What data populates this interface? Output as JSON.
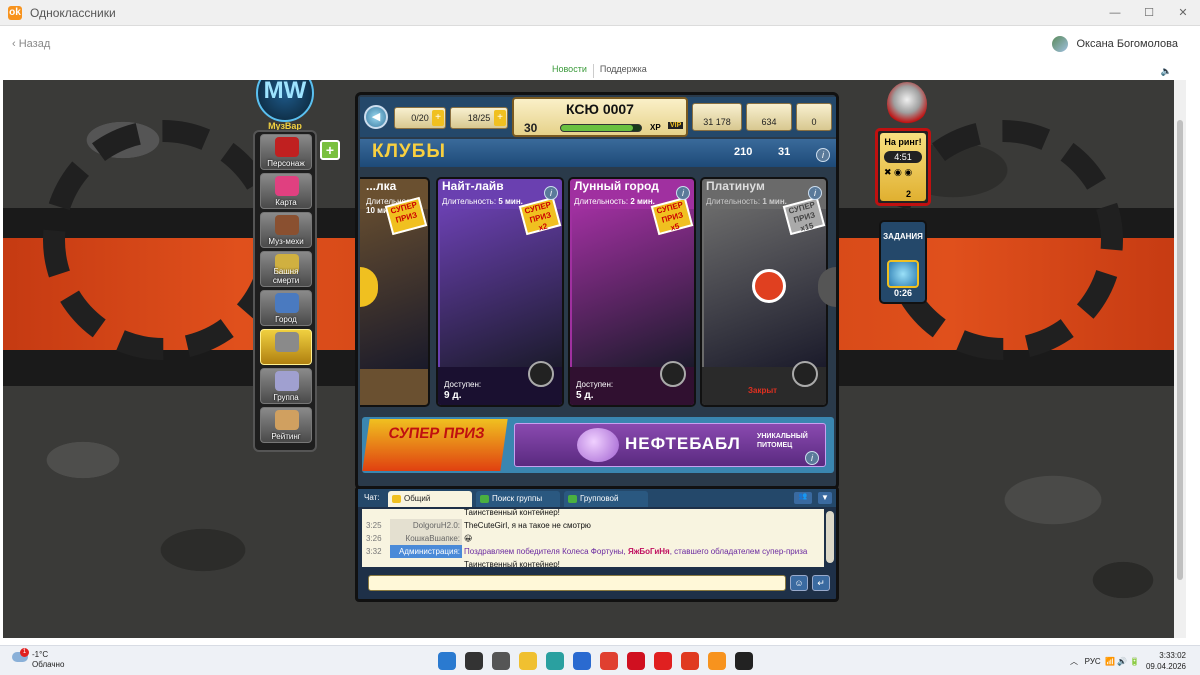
{
  "window": {
    "title": "Одноклассники",
    "min": "—",
    "max": "☐",
    "close": "✕"
  },
  "nav": {
    "back": "Назад",
    "user_name": "Оксана Богомолова"
  },
  "subnav": {
    "news": "Новости",
    "support": "Поддержка"
  },
  "game": {
    "logo": "MW",
    "logo_sub": "МузВар",
    "menu": [
      {
        "label": "Персонаж",
        "color": "#c02020"
      },
      {
        "label": "Карта",
        "color": "#e04080"
      },
      {
        "label": "Муз-мехи",
        "color": "#8a5030"
      },
      {
        "label": "Башня смерти",
        "color": "#d0b040"
      },
      {
        "label": "Город",
        "color": "#4a7ac0"
      },
      {
        "label": "",
        "color": "#8a8a8a"
      },
      {
        "label": "Группа",
        "color": "#a0a0d0"
      },
      {
        "label": "Рейтинг",
        "color": "#d0a060"
      }
    ],
    "add_button": "+",
    "topbar": {
      "weapons": "0/20",
      "energy": "18/25",
      "name": "КСЮ 0007",
      "level": "30",
      "xp_label": "XP",
      "vip": "VIP",
      "money": "31 178",
      "stars": "634",
      "gems": "0",
      "xp_fraction": 0.9
    },
    "clubs": {
      "title": "КЛУБЫ",
      "stat1": "210",
      "stat2": "31",
      "cards": [
        {
          "name": "...лка",
          "duration_label": "Длительность:",
          "duration": "10 мин.",
          "available_label": "",
          "available": "",
          "badge": "СУПЕР ПРИЗ",
          "multiplier": "",
          "bg": "#6a5030"
        },
        {
          "name": "Найт-лайв",
          "duration_label": "Длительность:",
          "duration": "5 мин.",
          "available_label": "Доступен:",
          "available": "9 д.",
          "badge": "СУПЕР ПРИЗ",
          "multiplier": "x2",
          "bg": "#6a40b0"
        },
        {
          "name": "Лунный город",
          "duration_label": "Длительность:",
          "duration": "2 мин.",
          "available_label": "Доступен:",
          "available": "5 д.",
          "badge": "СУПЕР ПРИЗ",
          "multiplier": "x5",
          "bg": "#a030a0"
        },
        {
          "name": "Платинум",
          "duration_label": "Длительность:",
          "duration": "1 мин.",
          "available_label": "",
          "available": "Закрыт",
          "badge": "СУПЕР ПРИЗ",
          "multiplier": "x15",
          "bg": "#6a6a6a"
        }
      ]
    },
    "banner": {
      "super": "СУПЕР ПРИЗ",
      "name": "НЕФТЕБАБЛ",
      "sub": "УНИКАЛЬНЫЙ ПИТОМЕЦ"
    },
    "chat": {
      "label": "Чат:",
      "tabs": [
        "Общий",
        "Поиск группы",
        "Групповой"
      ],
      "top_line": "Таинственный контейнер!",
      "rows": [
        {
          "time": "3:25",
          "who": "DolgoruH2.0:",
          "msg": "TheCuteGirl, я на такое не смотрю"
        },
        {
          "time": "3:26",
          "who": "КошкаВшапке:",
          "msg": "😀"
        },
        {
          "time": "3:32",
          "who": "Администрация:",
          "msg_pre": "Поздравляем победителя Колеса Фортуны, ",
          "msg_name": "ЯжБоГиНя",
          "msg_post": ", ставшего обладателем супер-приза"
        }
      ],
      "bottom_line": "Таинственный контейнер!",
      "input_placeholder": ""
    },
    "ring": {
      "title": "На ринг!",
      "timer": "4:51",
      "count": "2"
    },
    "tasks": {
      "title": "ЗАДАНИЯ",
      "timer": "0:26"
    }
  },
  "taskbar": {
    "temp": "-1°C",
    "weather": "Облачно",
    "badge": "1",
    "lang": "РУС",
    "time": "3:33:02",
    "date": "09.04.2026",
    "icons": [
      {
        "name": "windows-icon",
        "color": "#2a7ad0"
      },
      {
        "name": "search-icon",
        "color": "#333"
      },
      {
        "name": "taskview-icon",
        "color": "#555"
      },
      {
        "name": "explorer-icon",
        "color": "#f0c030"
      },
      {
        "name": "edge-icon",
        "color": "#2aa0a0"
      },
      {
        "name": "store-icon",
        "color": "#2a6ad0"
      },
      {
        "name": "chrome-icon",
        "color": "#e04030"
      },
      {
        "name": "opera-icon",
        "color": "#d01020"
      },
      {
        "name": "yandex-icon",
        "color": "#e02020"
      },
      {
        "name": "yandex-browser-icon",
        "color": "#e03a20"
      },
      {
        "name": "ok-icon",
        "color": "#f7931e"
      },
      {
        "name": "game-icon",
        "color": "#222"
      }
    ]
  }
}
